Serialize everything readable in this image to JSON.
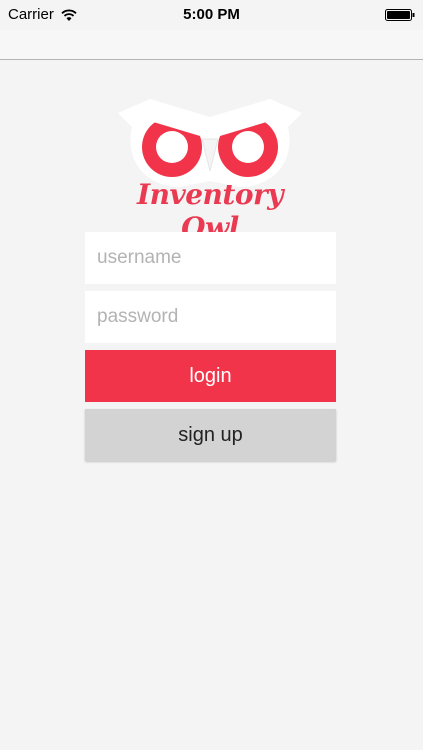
{
  "status_bar": {
    "carrier": "Carrier",
    "time": "5:00 PM",
    "wifi_icon": "wifi-icon",
    "battery_icon": "battery-icon"
  },
  "logo": {
    "text": "Inventory Owl",
    "icon": "owl-logo-icon",
    "accent_color": "#e93a52"
  },
  "form": {
    "username_placeholder": "username",
    "username_value": "",
    "password_placeholder": "password",
    "password_value": ""
  },
  "buttons": {
    "login_label": "login",
    "signup_label": "sign up"
  }
}
